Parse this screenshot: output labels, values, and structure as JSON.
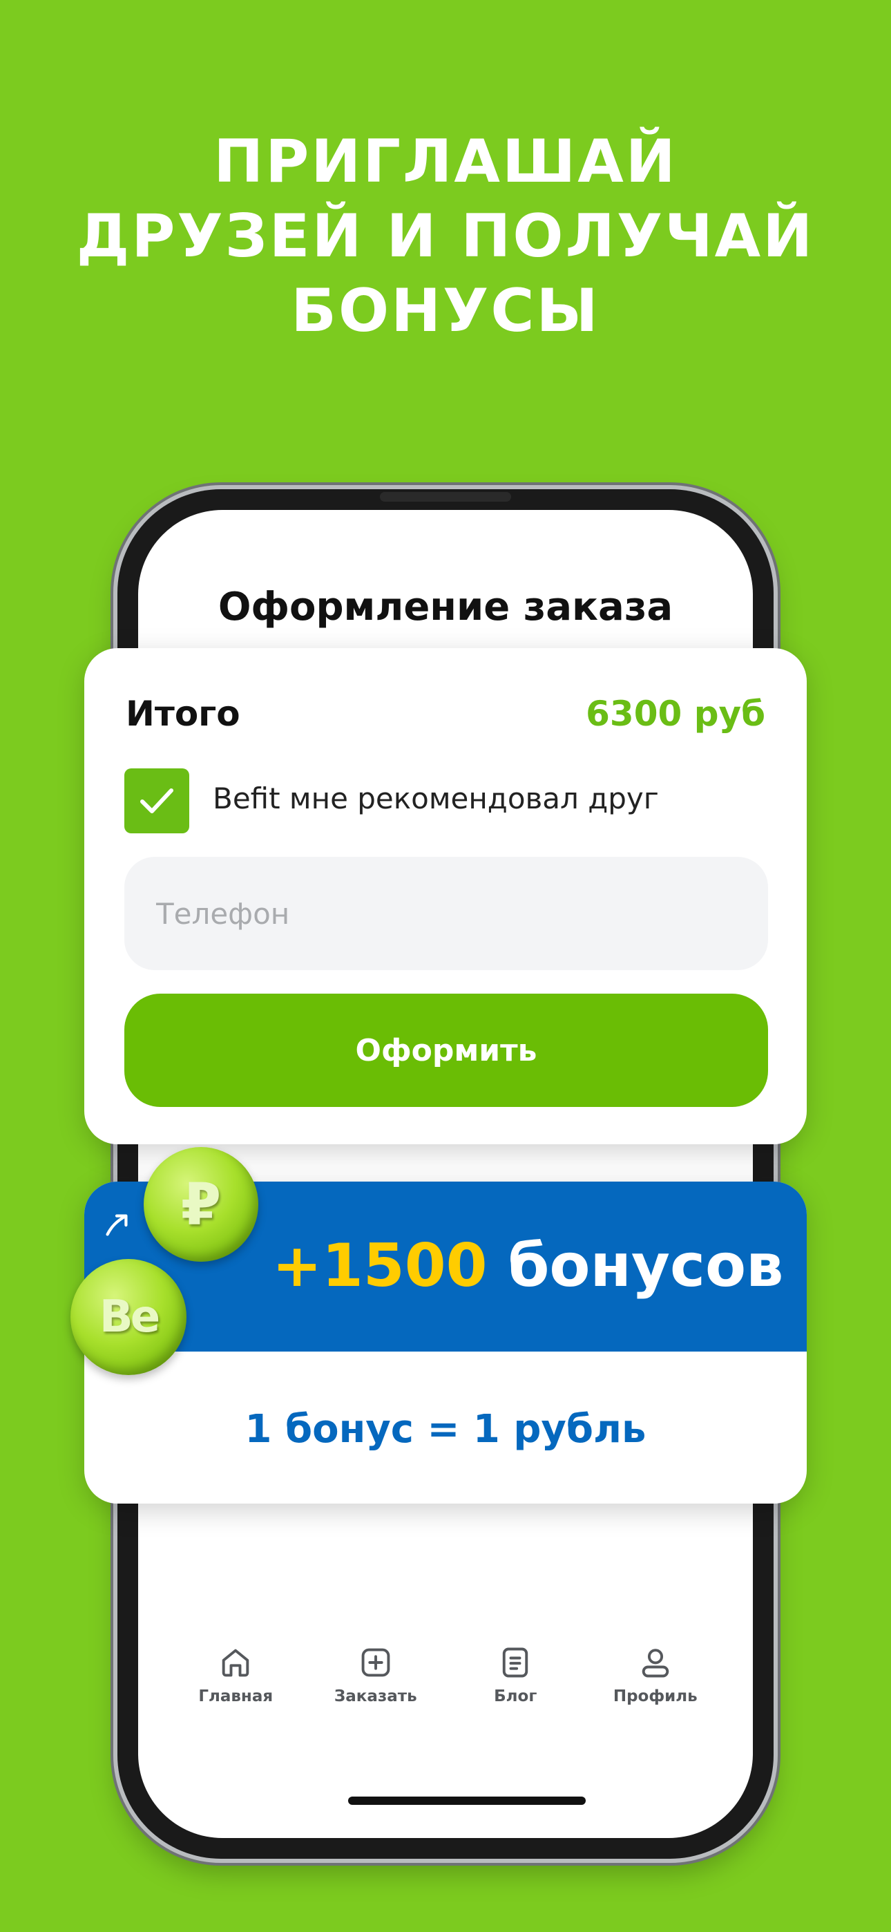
{
  "headline": {
    "line1": "ПРИГЛАШАЙ",
    "line2": "ДРУЗЕЙ И ПОЛУЧАЙ",
    "line3": "БОНУСЫ"
  },
  "screen": {
    "title": "Оформление заказа"
  },
  "order": {
    "total_label": "Итого",
    "total_value": "6300 руб",
    "referral_checked": true,
    "referral_label": "Befit мне рекомендовал друг",
    "phone_placeholder": "Телефон",
    "phone_value": "",
    "submit_label": "Оформить"
  },
  "bonus": {
    "amount": "+1500",
    "unit": "бонусов",
    "rate": "1 бонус = 1 рубль",
    "coin_rub": "₽",
    "coin_be": "Be"
  },
  "tabbar": {
    "items": [
      {
        "label": "Главная",
        "icon": "home-icon"
      },
      {
        "label": "Заказать",
        "icon": "plus-square-icon"
      },
      {
        "label": "Блог",
        "icon": "document-icon"
      },
      {
        "label": "Профиль",
        "icon": "user-icon"
      }
    ]
  },
  "colors": {
    "background": "#7ccb1f",
    "accent_green": "#6abd05",
    "bonus_blue": "#0568be",
    "bonus_yellow": "#ffcc00"
  }
}
